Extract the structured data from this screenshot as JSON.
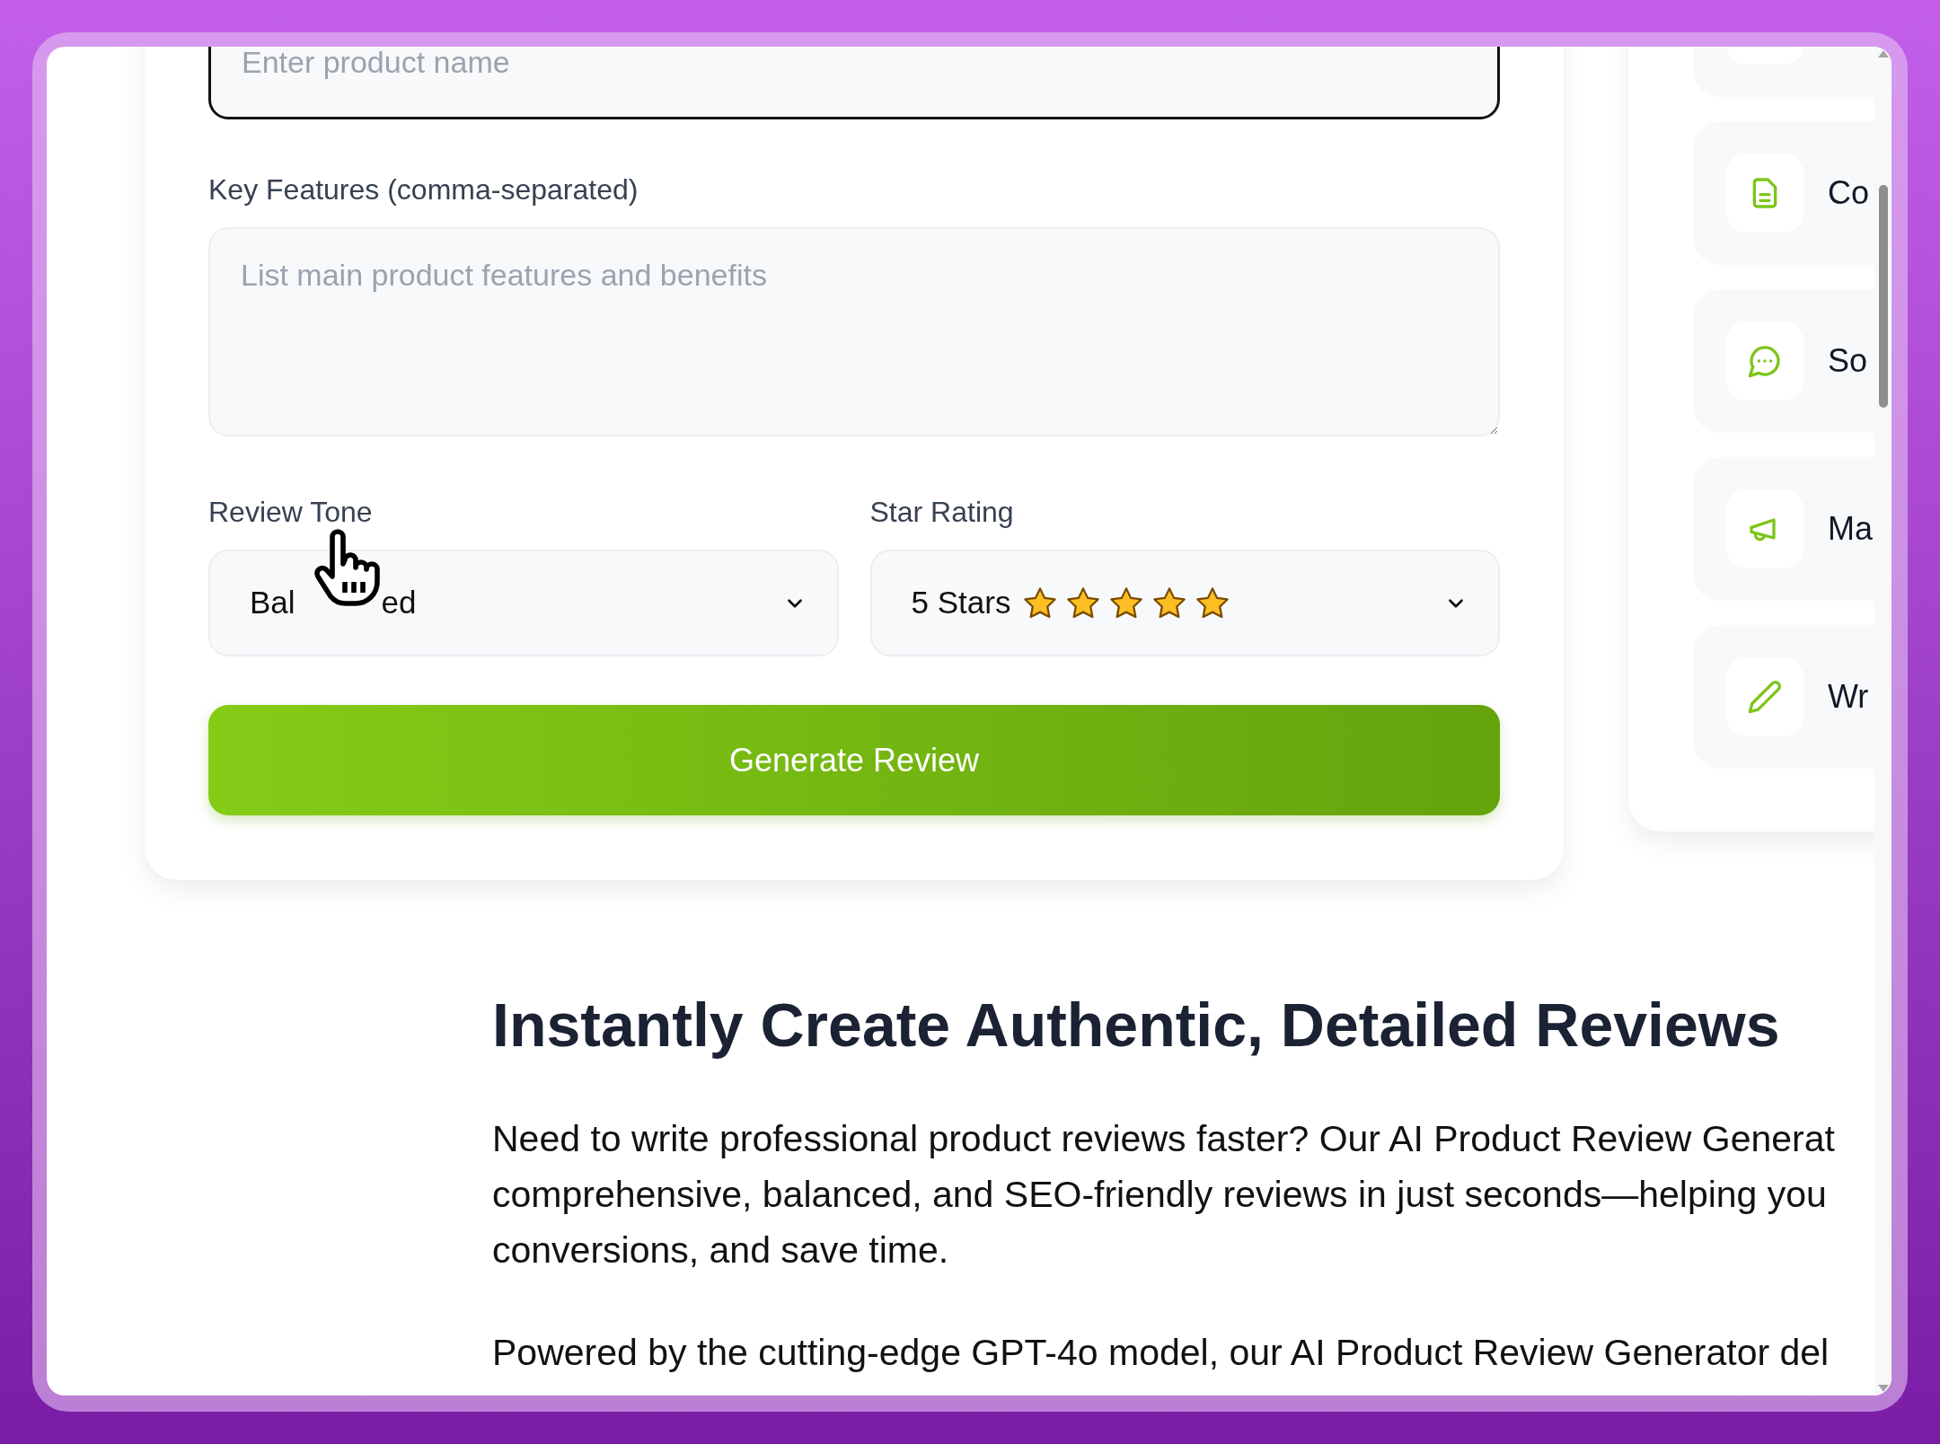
{
  "form": {
    "product_name": {
      "placeholder": "Enter product name"
    },
    "features": {
      "label": "Key Features (comma-separated)",
      "placeholder": "List main product features and benefits"
    },
    "tone": {
      "label": "Review Tone",
      "value_parts": [
        "Bal",
        "ed"
      ]
    },
    "rating": {
      "label": "Star Rating",
      "value": "5 Stars",
      "stars": 5
    },
    "submit": "Generate Review"
  },
  "side_panel": {
    "items": [
      {
        "label": "Co"
      },
      {
        "label": "So"
      },
      {
        "label": "Ma"
      },
      {
        "label": "Wr"
      }
    ]
  },
  "article": {
    "heading": "Instantly Create Authentic, Detailed Reviews",
    "paragraphs": [
      {
        "lines": [
          "Need to write professional product reviews faster? Our AI Product Review Generat",
          "comprehensive, balanced, and SEO-friendly reviews in just seconds—helping you",
          "conversions, and save time."
        ]
      },
      {
        "lines": [
          "Powered by the cutting-edge GPT-4o model, our AI Product Review Generator del"
        ]
      }
    ]
  }
}
